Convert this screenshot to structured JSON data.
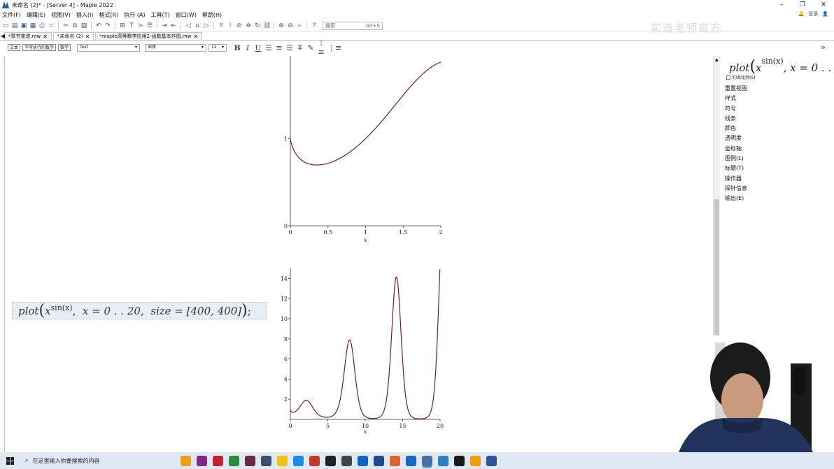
{
  "window": {
    "title": "未命名 (2)* - [Server 4] - Maple 2022",
    "controls": [
      "–",
      "❐",
      "✕"
    ]
  },
  "menubar": {
    "items": [
      "文件(F)",
      "编辑(E)",
      "视图(V)",
      "插入(I)",
      "格式(R)",
      "执行 (A)",
      "工具(T)",
      "窗口(W)",
      "帮助(H)"
    ],
    "login_label": "登录"
  },
  "toolbar": {
    "search_placeholder": "搜索",
    "search_shortcut": "Alt+S",
    "watermark": "实造老师官方"
  },
  "tabs": [
    {
      "label": "*章节变迹.mw",
      "active": false
    },
    {
      "label": "*未命名 (2)",
      "active": true
    },
    {
      "label": "*maple高等数学应用2-函数基本作图.mw",
      "active": false
    }
  ],
  "formatbar": {
    "text_mode": "文本",
    "nonexec_mode": "不可执行的数学",
    "math_mode": "数学",
    "style_value": "Text",
    "font_value": "宋体",
    "size_value": "12"
  },
  "document": {
    "command": {
      "fn": "plot",
      "base": "x",
      "exponent": "sin(x)",
      "range": "x = 0 . . 20",
      "size_opt": "size = [400, 400]",
      "terminator": ";"
    },
    "plot1": {
      "x_ticks": [
        "0",
        "0.5",
        "1",
        "1.5",
        "2"
      ],
      "y_ticks": [
        "0",
        "1"
      ],
      "x_label": "x",
      "line_color": "#6b1f2a"
    },
    "plot2": {
      "x_ticks": [
        "0",
        "5",
        "10",
        "15",
        "20"
      ],
      "y_ticks": [
        "2",
        "4",
        "6",
        "8",
        "10",
        "12",
        "14"
      ],
      "x_label": "x",
      "line_color": "#6b1f2a"
    }
  },
  "chart_data": [
    {
      "type": "line",
      "series": [
        {
          "function": "x^sin(x)"
        }
      ],
      "xlabel": "x",
      "xlim": [
        0,
        2
      ],
      "ylim": [
        0,
        1.95
      ]
    },
    {
      "type": "line",
      "series": [
        {
          "function": "x^sin(x)"
        }
      ],
      "xlabel": "x",
      "xlim": [
        0,
        20
      ],
      "ylim": [
        0,
        15
      ]
    }
  ],
  "context_panel": {
    "expr_fn": "plot",
    "expr_base": "x",
    "expr_exp": "sin(x)",
    "expr_rest": ",  x = 0 . .",
    "checkbox_label": "约束比例(S)",
    "items": [
      "重置视图",
      "样式",
      "符号",
      "线条",
      "颜色",
      "透明度",
      "坐标轴",
      "图例(L)",
      "标题(T)",
      "操作器",
      "探针信息",
      "输出(E)"
    ]
  },
  "taskbar": {
    "search_text": "在这里输入你要搜索的内容",
    "apps": [
      "#e8a317",
      "#7b2a8c",
      "#c4202f",
      "#2e8b3a",
      "#6b2b3a",
      "#3b4f6b",
      "#f1c40f",
      "#1e88e5",
      "#c0392b",
      "#222222",
      "#444444",
      "#1565c0",
      "#1e4a8a",
      "#e0632a",
      "#1769c4",
      "#4a6fa5",
      "#2c7fc1",
      "#1a1a1a",
      "#f39c12",
      "#3050a0"
    ],
    "active_app_index": 15
  }
}
